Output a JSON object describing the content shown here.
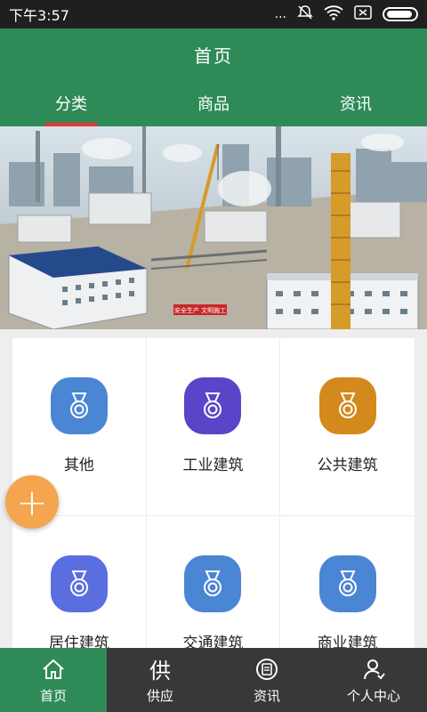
{
  "status_bar": {
    "time": "下午3:57",
    "dots": "...",
    "battery_icon": "battery-icon"
  },
  "header": {
    "title": "首页"
  },
  "tabs": [
    {
      "label": "分类",
      "active": true
    },
    {
      "label": "商品",
      "active": false
    },
    {
      "label": "资讯",
      "active": false
    }
  ],
  "banner": {
    "sign_text": "安全生产 文明施工"
  },
  "categories": [
    {
      "label": "其他",
      "color": "#4a86d4",
      "icon": "medal-icon"
    },
    {
      "label": "工业建筑",
      "color": "#5a45c8",
      "icon": "medal-icon"
    },
    {
      "label": "公共建筑",
      "color": "#d3891c",
      "icon": "medal-icon"
    },
    {
      "label": "居住建筑",
      "color": "#5b6ee0",
      "icon": "medal-icon"
    },
    {
      "label": "交通建筑",
      "color": "#4a86d4",
      "icon": "medal-icon"
    },
    {
      "label": "商业建筑",
      "color": "#4a86d4",
      "icon": "medal-icon"
    }
  ],
  "fab": {
    "symbol": "+"
  },
  "bottom_nav": [
    {
      "label": "首页",
      "icon": "home-icon",
      "active": true
    },
    {
      "label": "供应",
      "icon": "supply-icon",
      "glyph": "供",
      "active": false
    },
    {
      "label": "资讯",
      "icon": "news-icon",
      "active": false
    },
    {
      "label": "个人中心",
      "icon": "user-icon",
      "active": false
    }
  ],
  "colors": {
    "primary": "#2e8b57",
    "accent_underline": "#e53935",
    "fab": "#f5a54f",
    "nav_dark": "#383838"
  }
}
